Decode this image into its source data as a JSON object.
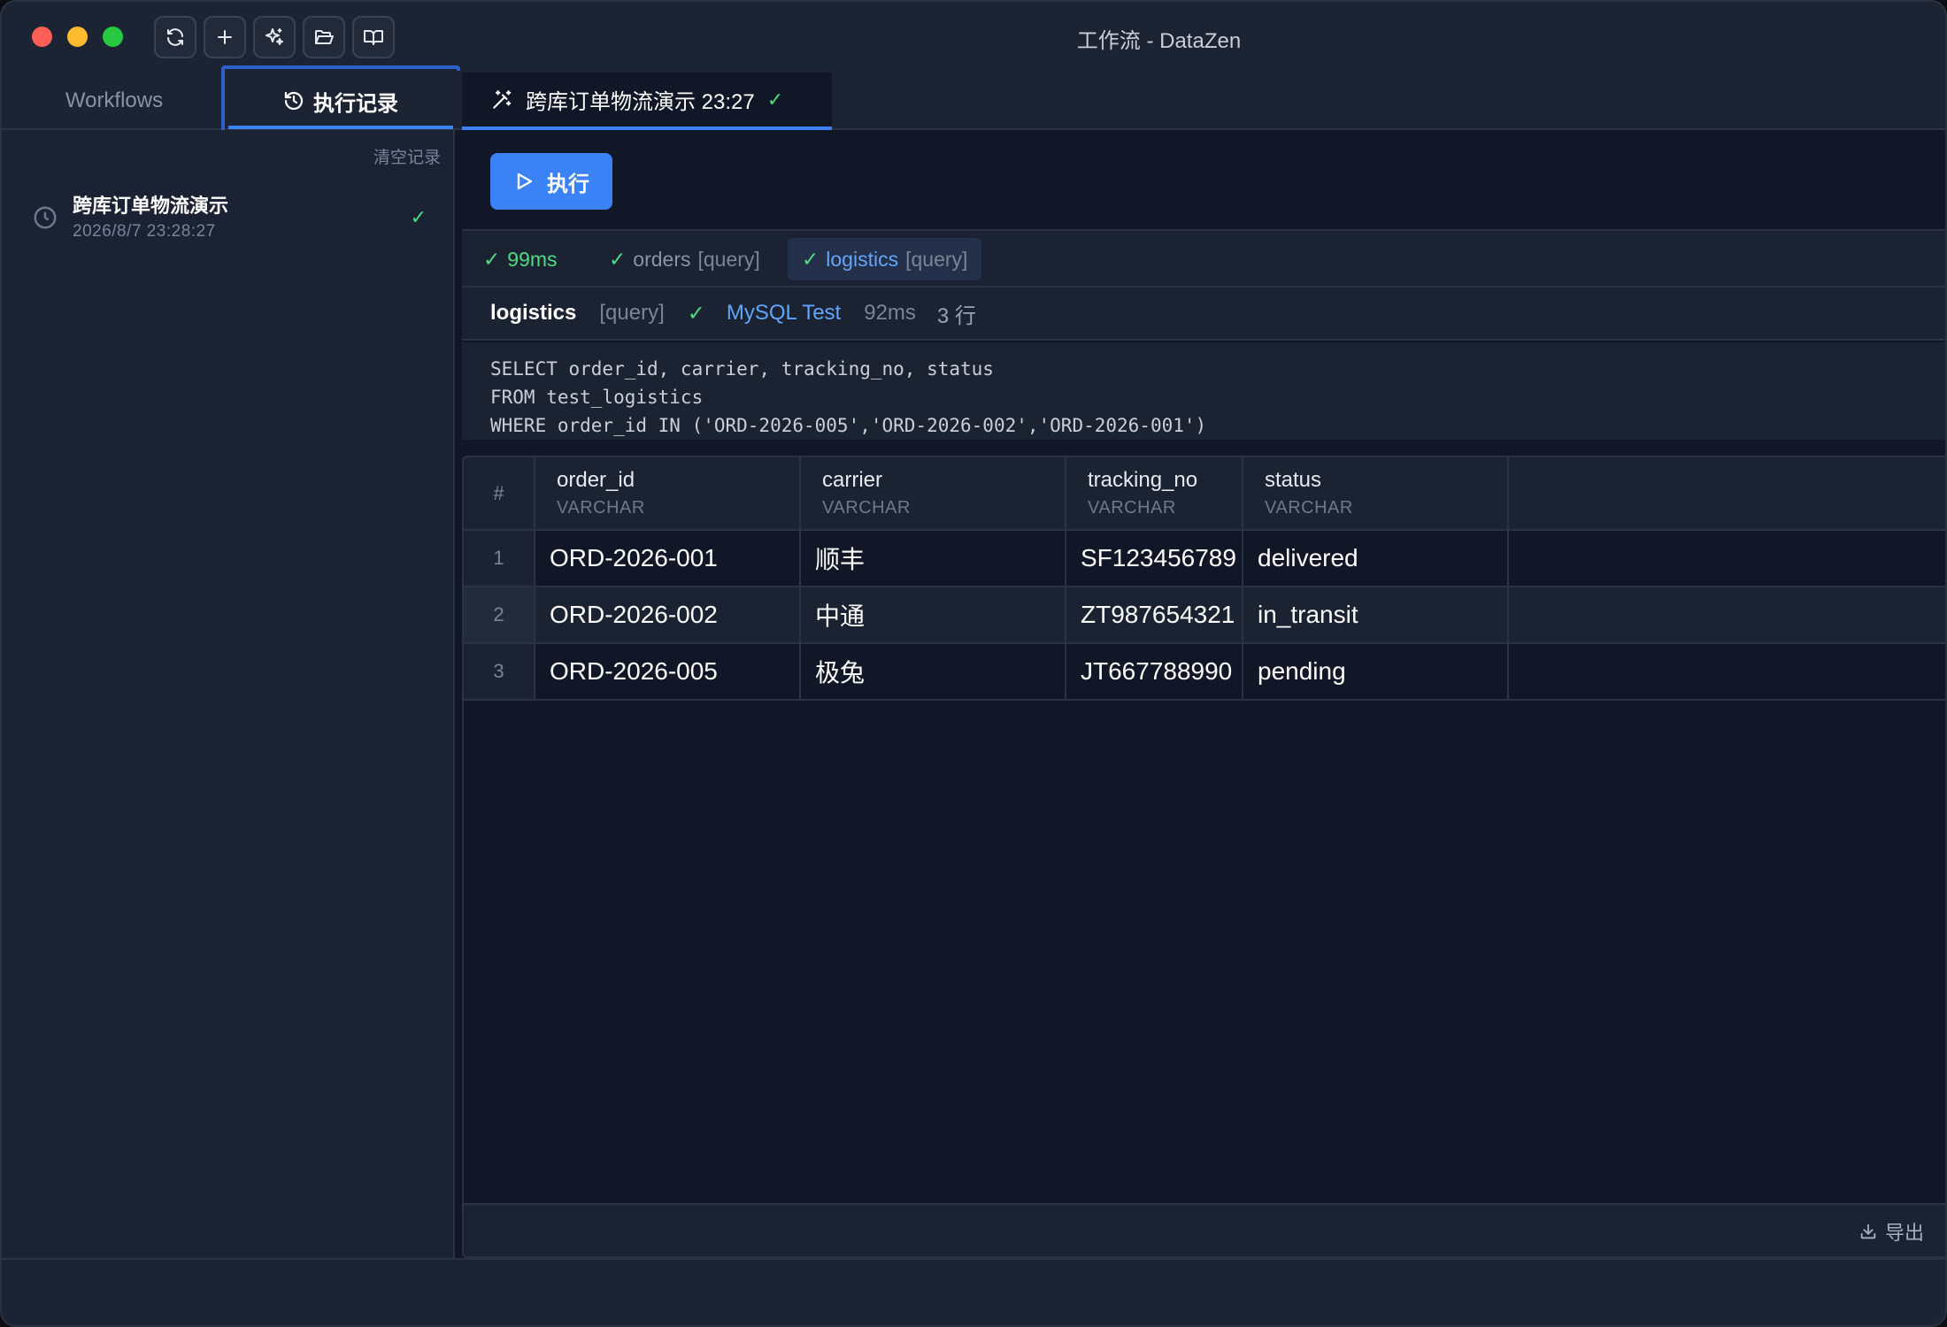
{
  "window": {
    "title": "工作流 - DataZen"
  },
  "toolbar": {
    "icons": [
      "refresh-icon",
      "plus-icon",
      "sparkles-icon",
      "folder-open-icon",
      "book-open-icon"
    ]
  },
  "sidebar": {
    "tabs": {
      "workflows": "Workflows",
      "history": "执行记录"
    },
    "clear_label": "清空记录",
    "history_items": [
      {
        "name": "跨库订单物流演示",
        "time": "2026/8/7 23:28:27",
        "status": "✓"
      }
    ]
  },
  "main": {
    "tab": {
      "label": "跨库订单物流演示 23:27",
      "status": "✓"
    },
    "run_label": "执行",
    "summary": {
      "total": {
        "mark": "✓",
        "duration": "99ms"
      },
      "steps": [
        {
          "mark": "✓",
          "name": "orders",
          "type": "[query]"
        },
        {
          "mark": "✓",
          "name": "logistics",
          "type": "[query]"
        }
      ]
    },
    "detail": {
      "name": "logistics",
      "type": "[query]",
      "mark": "✓",
      "datasource": "MySQL Test",
      "duration": "92ms",
      "rows": "3 行"
    },
    "sql": "SELECT order_id, carrier, tracking_no, status\nFROM test_logistics\nWHERE order_id IN ('ORD-2026-005','ORD-2026-002','ORD-2026-001')",
    "grid": {
      "index_header": "#",
      "columns": [
        {
          "name": "order_id",
          "type": "VARCHAR"
        },
        {
          "name": "carrier",
          "type": "VARCHAR"
        },
        {
          "name": "tracking_no",
          "type": "VARCHAR"
        },
        {
          "name": "status",
          "type": "VARCHAR"
        }
      ],
      "rows": [
        {
          "index": "1",
          "cells": [
            "ORD-2026-001",
            "顺丰",
            "SF123456789",
            "delivered"
          ]
        },
        {
          "index": "2",
          "cells": [
            "ORD-2026-002",
            "中通",
            "ZT987654321",
            "in_transit"
          ]
        },
        {
          "index": "3",
          "cells": [
            "ORD-2026-005",
            "极兔",
            "JT667788990",
            "pending"
          ]
        }
      ]
    },
    "export_label": "导出"
  },
  "colors": {
    "accent": "#3b82f6",
    "success": "#4ade80",
    "link": "#60a5fa",
    "background": "#111726"
  }
}
